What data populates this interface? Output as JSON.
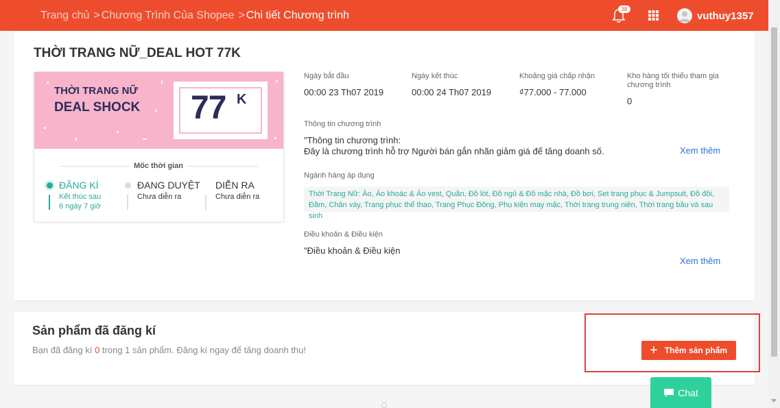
{
  "header": {
    "breadcrumb": {
      "home": "Trang chủ",
      "programs": "Chương Trình Của Shopee",
      "current": "Chi tiết Chương trình",
      "separator": ">"
    },
    "notification_count": "38",
    "username": "vuthuy1357",
    "icons": [
      "bell-icon",
      "apps-grid-icon",
      "user-avatar-icon"
    ],
    "accent_color": "#ee4d2d"
  },
  "program": {
    "title": "THỜI TRANG NỮ_DEAL HOT 77K",
    "banner": {
      "line1": "THỜI TRANG NỮ",
      "line2": "DEAL SHOCK",
      "price": "77",
      "price_suffix": "K"
    },
    "milestone": {
      "label": "Mốc thời gian",
      "stages": [
        {
          "name": "ĐĂNG KÍ",
          "sub1": "Kết thúc sau",
          "sub2": "6 ngày 7 giờ"
        },
        {
          "name": "ĐANG DUYỆT",
          "sub1": "Chưa diễn ra"
        },
        {
          "name": "DIỄN RA",
          "sub1": "Chưa diễn ra"
        }
      ]
    },
    "info": {
      "start_label": "Ngày bắt đầu",
      "start_value": "00:00 23 Th07 2019",
      "end_label": "Ngày kết thúc",
      "end_value": "00:00 24 Th07 2019",
      "price_label": "Khoảng giá chấp nhận",
      "price_value": "₫77.000 - 77.000",
      "stock_label_1": "Kho hàng tối thiểu tham gia",
      "stock_label_2": "chương trình",
      "stock_value": "0"
    },
    "program_info": {
      "label": "Thông tin chương trình",
      "line1": "\"Thông tin chương trình:",
      "line2": "Đây là chương trình hỗ trợ Người bán gắn nhãn giảm giá để tăng doanh số.",
      "more": "Xem thêm"
    },
    "categories": {
      "label": "Ngành hàng áp dụng",
      "line1": "Thời Trang Nữ: Áo, Áo khoác & Áo vest, Quần, Đồ lót, Đồ ngủ & Đồ mặc nhà, Đồ bơi, Set trang phục & Jumpsuit, Đồ đôi,",
      "line2": "Đầm, Chân váy, Trang phục thể thao, Trang Phục Đông, Phụ kiện may mặc, Thời trang trung niên, Thời trang bầu và sau sinh"
    },
    "terms": {
      "label": "Điều khoản & Điều kiện",
      "line1": "\"Điều khoản & Điều kiện",
      "more": "Xem thêm"
    }
  },
  "registered": {
    "title": "Sản phẩm đã đăng kí",
    "desc_prefix": "Bạn đã đăng kí ",
    "count": "0",
    "desc_suffix": " trong 1 sản phẩm.  Đăng kí ngay để tăng doanh thu!",
    "add_button": "Thêm sản phẩm"
  },
  "chat": {
    "label": "Chat",
    "color": "#2ed19b"
  }
}
